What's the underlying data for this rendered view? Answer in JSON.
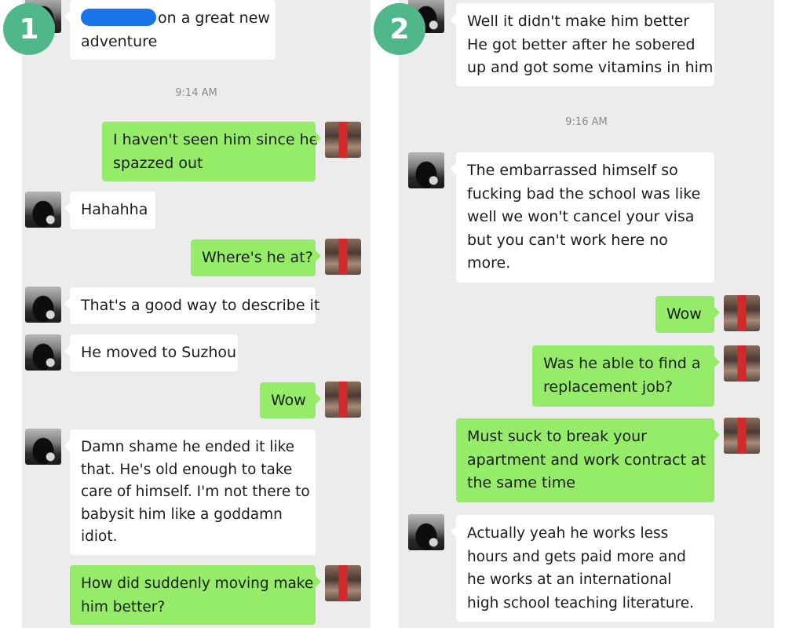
{
  "badges": {
    "left": "1",
    "right": "2"
  },
  "panel1": {
    "msg0": {
      "text_after_redaction": "on a great new",
      "line2": "adventure"
    },
    "time": "9:14 AM",
    "msg1": {
      "lines": [
        "I haven't seen him since he",
        "spazzed out"
      ]
    },
    "msg2": {
      "lines": [
        "Hahahha"
      ]
    },
    "msg3": {
      "lines": [
        "Where's he at?"
      ]
    },
    "msg4": {
      "lines": [
        "That's a good way to describe it"
      ]
    },
    "msg5": {
      "lines": [
        "He moved to Suzhou"
      ]
    },
    "msg6": {
      "lines": [
        "Wow"
      ]
    },
    "msg7": {
      "lines": [
        "Damn shame he ended it like",
        "that. He's old enough to take",
        "care of himself.  I'm not there to",
        "babysit him like a goddamn",
        "idiot."
      ]
    },
    "msg8": {
      "lines": [
        "How did suddenly moving make",
        "him better?"
      ]
    }
  },
  "panel2": {
    "msg0": {
      "lines": [
        "Well it didn't make him better",
        "He got better after he sobered",
        "up and got some vitamins in him"
      ]
    },
    "time": "9:16 AM",
    "msg1": {
      "lines": [
        "The embarrassed himself so",
        "fucking bad the school was like",
        "well we won't cancel your visa",
        "but you can't work here no",
        "more."
      ]
    },
    "msg2": {
      "lines": [
        "Wow"
      ]
    },
    "msg3": {
      "lines": [
        "Was he able to find a",
        "replacement job?"
      ]
    },
    "msg4": {
      "lines": [
        "Must suck to break your",
        "apartment and work contract at",
        "the same time"
      ]
    },
    "msg5": {
      "lines": [
        "Actually yeah he works less",
        "hours and gets paid more and",
        "he works at an international",
        "high school teaching literature."
      ]
    }
  }
}
